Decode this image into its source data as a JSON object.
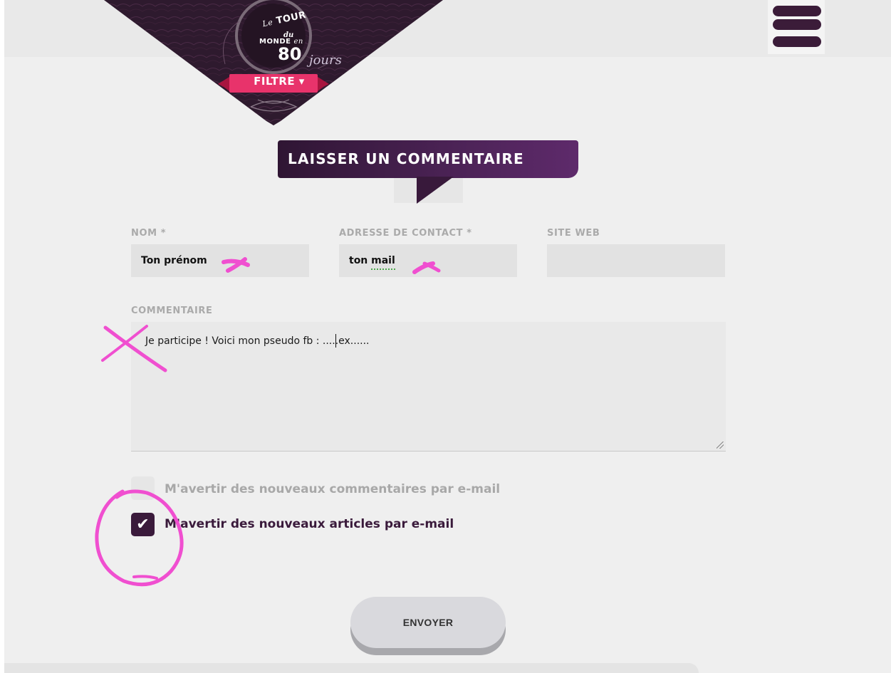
{
  "header": {
    "logo": {
      "line1": "Le",
      "line2": "TOUR",
      "line3": "du",
      "line4": "MONDE",
      "line5": "en",
      "line6": "80",
      "line7": "jours"
    },
    "filter_label": "FILTRE ▾"
  },
  "comment_form": {
    "title": "LAISSER UN COMMENTAIRE",
    "name": {
      "label": "NOM *",
      "value": "Ton prénom"
    },
    "email": {
      "label": "ADRESSE DE CONTACT *",
      "value": "ton mail"
    },
    "website": {
      "label": "SITE WEB",
      "value": ""
    },
    "comment": {
      "label": "COMMENTAIRE",
      "value": "Je participe ! Voici mon pseudo fb :  .....ex......"
    },
    "notify_comments": {
      "label": "M'avertir des nouveaux commentaires par e-mail",
      "checked": false
    },
    "notify_articles": {
      "label": "M'avertir des nouveaux articles par e-mail",
      "checked": true
    },
    "submit_label": "ENVOYER"
  },
  "colors": {
    "brand_dark": "#3a1a3b",
    "filter_pink": "#e8336b",
    "annotation_pink": "#f04fd0",
    "page_bg": "#efefef"
  }
}
